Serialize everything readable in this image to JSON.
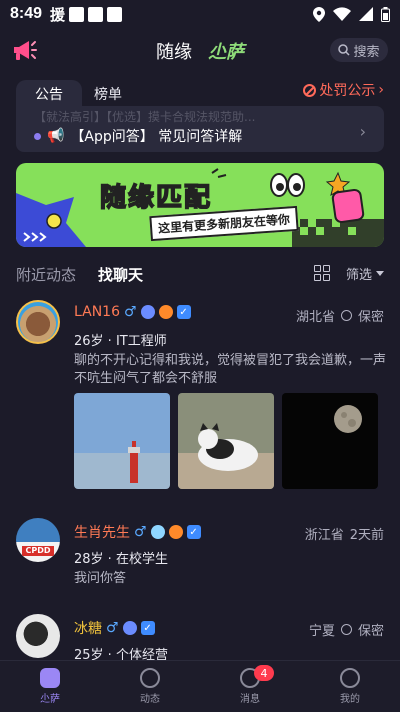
{
  "status": {
    "time": "8:49",
    "notif_char": "援"
  },
  "header": {
    "tab_main": "随缘",
    "tab_active": "尐萨",
    "search_label": "搜索"
  },
  "notice": {
    "tabs": [
      "公告",
      "榜单"
    ],
    "penalty_label": "处罚公示",
    "faded_text": "【就法高引】【优选】摸卡合规法规范助...",
    "line_text": "【App问答】 常见问答详解"
  },
  "banner": {
    "title": "随缘匹配",
    "subtitle": "这里有更多新朋友在等你"
  },
  "subtabs": {
    "nearby": "附近动态",
    "chat": "找聊天",
    "filter": "筛选"
  },
  "users": [
    {
      "name": "LAN16",
      "gender": "♂",
      "location": "湖北省",
      "privacy": "保密",
      "meta": "26岁 · IT工程师",
      "bio": "聊的不开心记得和我说，觉得被冒犯了我会道歉，一声不吭生闷气了都会不舒服"
    },
    {
      "name": "生肖先生",
      "gender": "♂",
      "location": "浙江省",
      "privacy": "2天前",
      "meta": "28岁 · 在校学生",
      "bio": "我问你答",
      "avatar_text": "CPDD"
    },
    {
      "name": "冰糖",
      "gender": "♂",
      "location": "宁夏",
      "privacy": "保密",
      "meta": "25岁 · 个体经营"
    }
  ],
  "nav": [
    {
      "label": "尐萨"
    },
    {
      "label": "动态"
    },
    {
      "label": "消息",
      "badge": "4"
    },
    {
      "label": "我的"
    }
  ],
  "colors": {
    "bg": "#1c1b29",
    "accent": "#9b87f5",
    "name": "#ff7a55",
    "banner": "#86e05a"
  }
}
